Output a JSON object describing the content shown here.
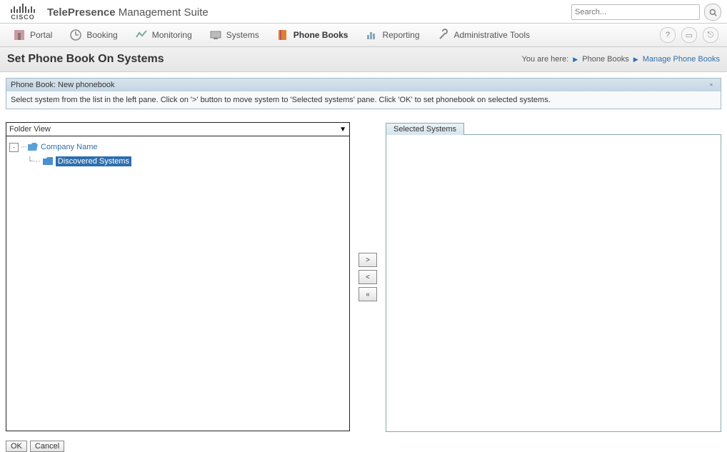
{
  "app": {
    "title_bold": "TelePresence",
    "title_rest": " Management Suite",
    "logo_text": "CISCO"
  },
  "search": {
    "placeholder": "Search..."
  },
  "nav": {
    "items": [
      {
        "label": "Portal"
      },
      {
        "label": "Booking"
      },
      {
        "label": "Monitoring"
      },
      {
        "label": "Systems"
      },
      {
        "label": "Phone Books"
      },
      {
        "label": "Reporting"
      },
      {
        "label": "Administrative Tools"
      }
    ],
    "active_index": 4
  },
  "page": {
    "title": "Set Phone Book On Systems",
    "breadcrumb": {
      "prefix": "You are here:",
      "a": "Phone Books",
      "b": "Manage Phone Books"
    }
  },
  "strip": {
    "head": "Phone Book: New phonebook",
    "body": "Select system from the list in the left pane. Click on '>' button to move system to 'Selected systems' pane. Click 'OK' to set phonebook on selected systems."
  },
  "folder": {
    "head": "Folder View",
    "root": "Company Name",
    "child": "Discovered Systems"
  },
  "selected": {
    "tab": "Selected Systems"
  },
  "move": {
    "add": ">",
    "remove": "<",
    "remove_all": "«"
  },
  "buttons": {
    "ok": "OK",
    "cancel": "Cancel"
  },
  "util": {
    "help": "?"
  }
}
